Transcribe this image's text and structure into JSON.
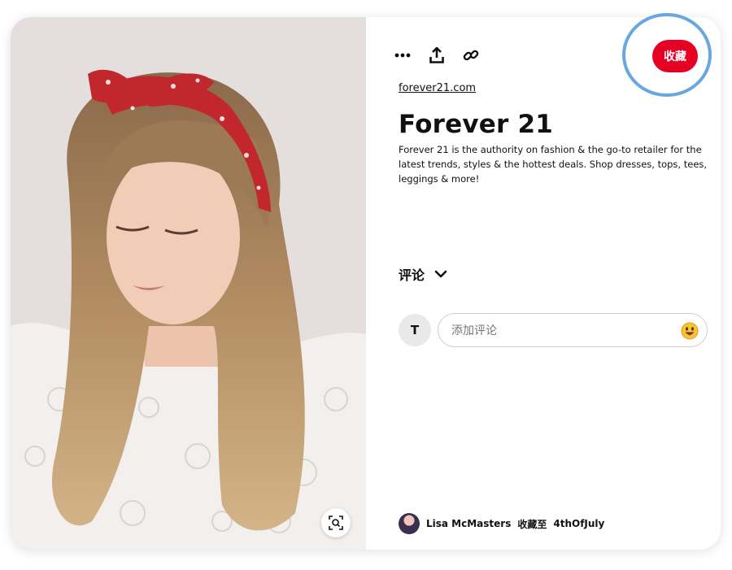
{
  "pin": {
    "source_link": "forever21.com",
    "title": "Forever 21",
    "description": "Forever 21 is the authority on fashion & the go-to retailer for the latest trends, styles & the hottest deals. Shop dresses, tops, tees, leggings & more!",
    "save_label": "收藏"
  },
  "toolbar": {
    "icons": [
      "more-icon",
      "share-icon",
      "link-icon"
    ]
  },
  "comments": {
    "heading": "评论",
    "user_initial": "T",
    "placeholder": "添加评论"
  },
  "saved_by": {
    "user": "Lisa McMasters",
    "action": "收藏至",
    "board": "4thOfJuly"
  },
  "colors": {
    "save_button": "#e60023",
    "highlight_ring": "#6aa6e0"
  }
}
